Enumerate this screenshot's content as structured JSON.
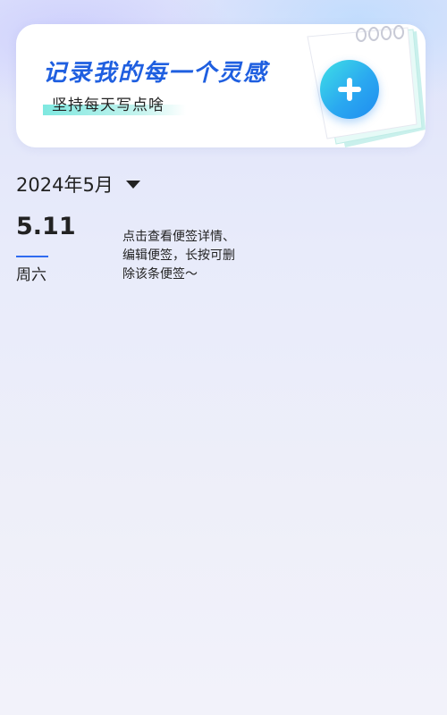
{
  "banner": {
    "title": "记录我的每一个灵感",
    "subtitle": "坚持每天写点啥",
    "add_icon": "plus-icon",
    "illustration_icon": "notebook-icon",
    "accent_color": "#1f5fe0"
  },
  "month_selector": {
    "label": "2024年5月",
    "icon": "caret-down-icon"
  },
  "day_entry": {
    "date": "5.11",
    "weekday": "周六",
    "underline_color": "#2f6bf0"
  },
  "hint": {
    "lines": [
      "点击查看便签详情、",
      "编辑便签，长按可删",
      "除该条便签～"
    ]
  }
}
